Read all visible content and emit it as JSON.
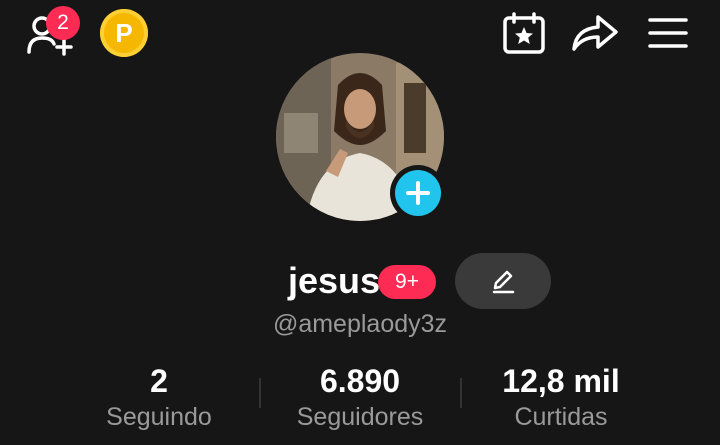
{
  "header": {
    "friend_requests_count": "2",
    "coin_letter": "P"
  },
  "profile": {
    "display_name": "jesus",
    "notifications_badge": "9+",
    "handle": "@ameplaody3z"
  },
  "stats": {
    "following": {
      "value": "2",
      "label": "Seguindo"
    },
    "followers": {
      "value": "6.890",
      "label": "Seguidores"
    },
    "likes": {
      "value": "12,8 mil",
      "label": "Curtidas"
    }
  },
  "colors": {
    "background": "#161616",
    "badge": "#fe2c55",
    "add_button": "#20c4ec",
    "coin": "#f5b700",
    "muted_text": "#9a9a9a"
  }
}
